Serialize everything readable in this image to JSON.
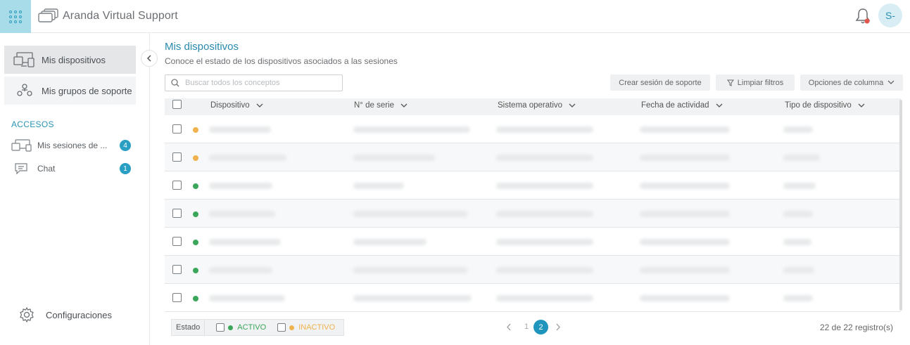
{
  "header": {
    "app_name": "Aranda Virtual Support",
    "avatar_initials": "S-",
    "accent": "#a9dce9",
    "notification_dot_color": "#e2554b"
  },
  "sidebar": {
    "items": [
      {
        "label": "Mis dispositivos",
        "icon": "devices-icon",
        "active": true
      },
      {
        "label": "Mis grupos de soporte",
        "icon": "support-groups-icon",
        "active": false
      }
    ],
    "section_title": "ACCESOS",
    "accesos": [
      {
        "label": "Mis sesiones de ...",
        "icon": "sessions-icon",
        "count": "4"
      },
      {
        "label": "Chat",
        "icon": "chat-icon",
        "count": "1"
      }
    ],
    "settings_label": "Configuraciones"
  },
  "main": {
    "title": "Mis dispositivos",
    "subtitle": "Conoce el estado de los dispositivos asociados a las sesiones",
    "search_placeholder": "Buscar todos los conceptos",
    "buttons": {
      "create_session": "Crear sesión de soporte",
      "clear_filters": "Limpiar filtros",
      "column_options": "Opciones de columna"
    }
  },
  "table": {
    "columns": [
      "Dispositivo",
      "N° de serie",
      "Sistema operativo",
      "Fecha de actividad",
      "Tipo de dispositivo"
    ],
    "rows": [
      {
        "status": "inactive"
      },
      {
        "status": "inactive"
      },
      {
        "status": "active"
      },
      {
        "status": "active"
      },
      {
        "status": "active"
      },
      {
        "status": "active"
      },
      {
        "status": "active"
      }
    ],
    "status_colors": {
      "active": "#3aa65a",
      "inactive": "#f0b24d"
    }
  },
  "footer": {
    "estado_label": "Estado",
    "active_label": "ACTIVO",
    "inactive_label": "INACTIVO",
    "pages": [
      "1",
      "2"
    ],
    "current_page": "2",
    "records": "22 de 22 registro(s)"
  }
}
